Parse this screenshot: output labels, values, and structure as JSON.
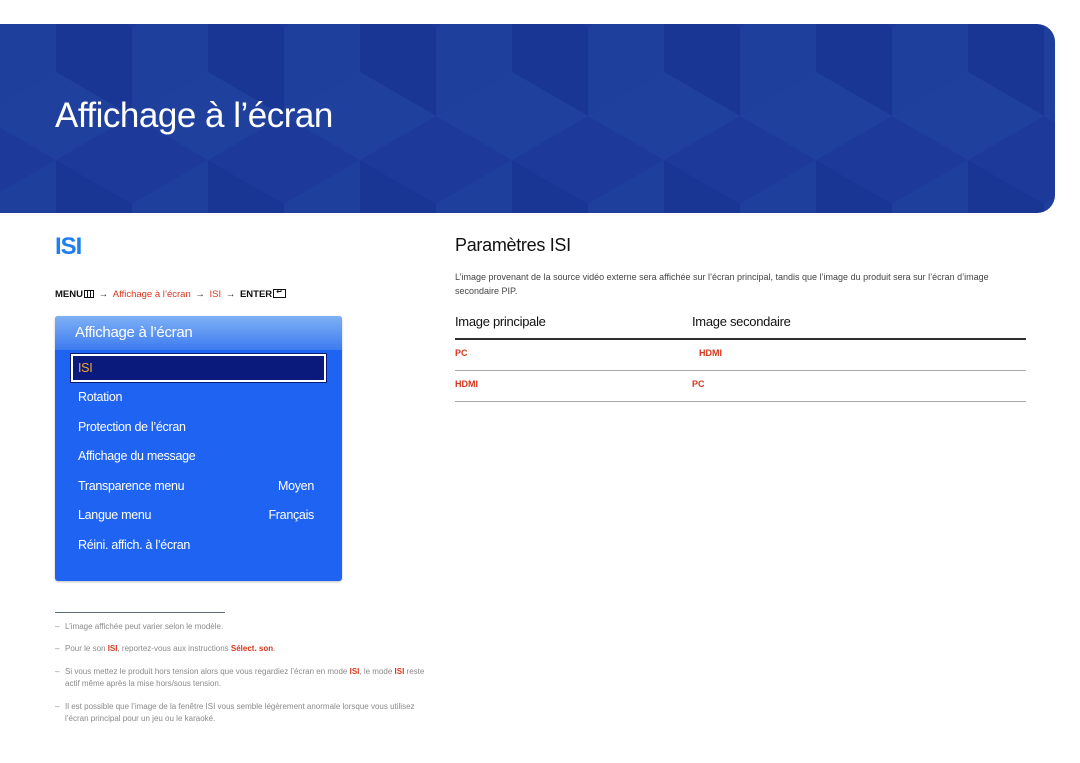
{
  "banner": {
    "title": "Affichage à l’écran"
  },
  "left": {
    "heading": "ISI",
    "menu_path": {
      "menu_label": "MENU",
      "menu_icon": "menu-icon",
      "arrow": "→",
      "step1": "Affichage à l’écran",
      "step2": "ISI",
      "enter_label": "ENTER",
      "enter_icon": "enter-icon"
    },
    "osd": {
      "title": "Affichage à l’écran",
      "items": [
        {
          "label": "ISI",
          "value": "",
          "selected": true
        },
        {
          "label": "Rotation",
          "value": ""
        },
        {
          "label": "Protection de l’écran",
          "value": ""
        },
        {
          "label": "Affichage du message",
          "value": ""
        },
        {
          "label": "Transparence menu",
          "value": "Moyen"
        },
        {
          "label": "Langue menu",
          "value": "Français"
        },
        {
          "label": "Réini. affich. à l’écran",
          "value": ""
        }
      ]
    },
    "footnotes": {
      "dash": "–",
      "n1": {
        "text": "L’image affichée peut varier selon le modèle."
      },
      "n2": {
        "a": "Pour le son ",
        "b": "ISI",
        "c": ", reportez-vous aux instructions ",
        "d": "Sélect. son",
        "e": "."
      },
      "n3": {
        "a": "Si vous mettez le produit hors tension alors que vous regardiez l’écran en mode ",
        "b": "ISI",
        "c": ", le mode ",
        "d": "ISI",
        "e": " reste actif même après la mise hors/sous tension."
      },
      "n4": {
        "text": "Il est possible que l’image de la fenêtre ISI vous semble légèrement anormale lorsque vous utilisez l’écran principal pour un jeu ou le karaoké."
      }
    }
  },
  "right": {
    "heading": "Paramètres ISI",
    "description": "L’image provenant de la source vidéo externe sera affichée sur l’écran principal, tandis que l’image du produit sera sur l’écran d’image secondaire PIP.",
    "table": {
      "headers": [
        "Image principale",
        "Image secondaire"
      ],
      "rows": [
        [
          "PC",
          "HDMI"
        ],
        [
          "HDMI",
          "PC"
        ]
      ]
    }
  },
  "colors": {
    "banner_blue": "#1d3a9a",
    "heading_blue": "#1e7ef0",
    "accent_red": "#d6361c",
    "osd_blue": "#1f63f2",
    "osd_selected": "#0a1a7c",
    "osd_selected_text": "#f2a836"
  }
}
